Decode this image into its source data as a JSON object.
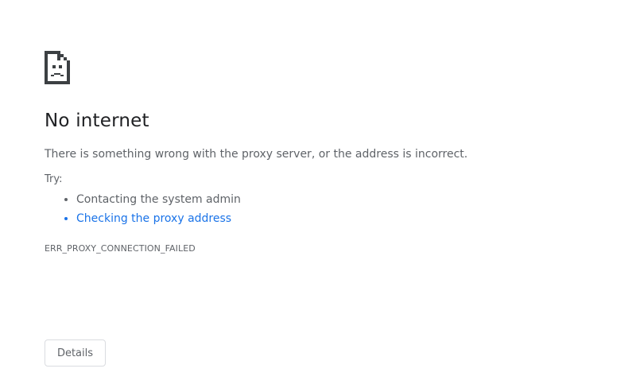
{
  "error_page": {
    "icon": "sad-document-icon",
    "title": "No internet",
    "description": "There is something wrong with the proxy server, or the address is incorrect.",
    "try_label": "Try:",
    "suggestions": [
      {
        "label": "Contacting the system admin",
        "is_link": false
      },
      {
        "label": "Checking the proxy address",
        "is_link": true
      }
    ],
    "error_code": "ERR_PROXY_CONNECTION_FAILED",
    "details_button_label": "Details"
  },
  "colors": {
    "text_primary": "#202124",
    "text_secondary": "#5f6368",
    "link": "#1a73e8",
    "button_border": "#dadce0",
    "icon": "#3c4043"
  }
}
